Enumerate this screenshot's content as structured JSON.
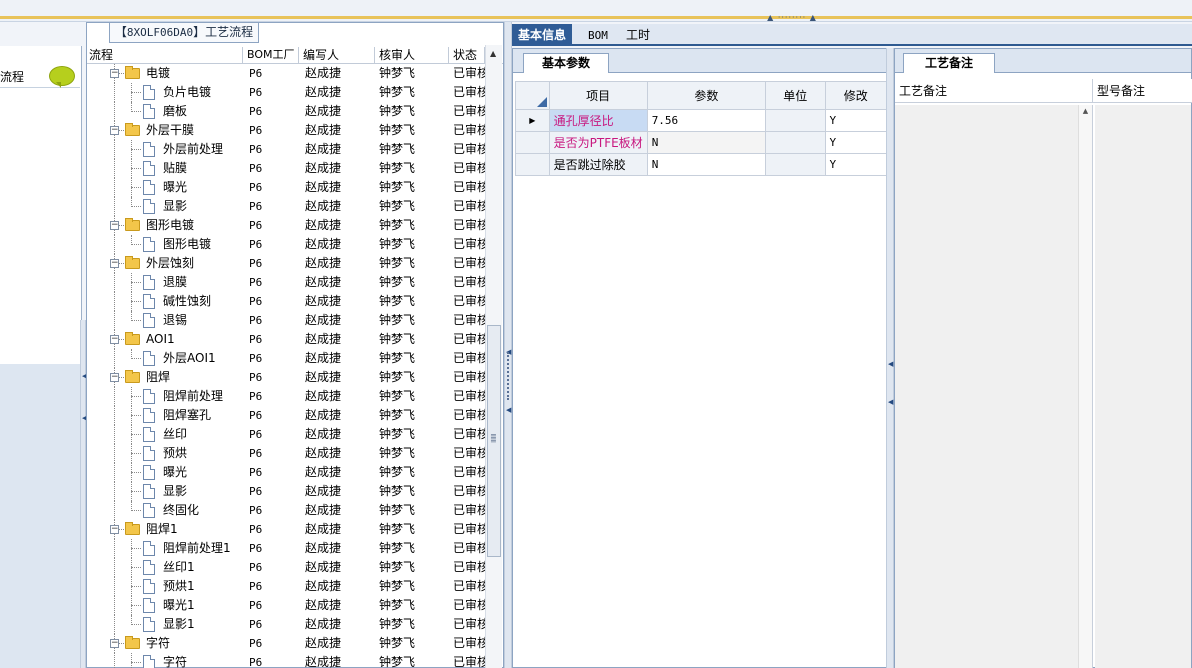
{
  "tree_panel": {
    "title_bracket_open": "【",
    "title_code": "8XOLF06DA0",
    "title_bracket_close": "】",
    "title_text": "工艺流程",
    "columns": [
      "流程",
      "BOM工厂",
      "编写人",
      "核审人",
      "状态"
    ],
    "rows": [
      {
        "name": "电镀",
        "type": "folder",
        "bom": "P6",
        "author": "赵成捷",
        "reviewer": "钟梦飞",
        "status": "已审核"
      },
      {
        "name": "负片电镀",
        "type": "doc",
        "bom": "P6",
        "author": "赵成捷",
        "reviewer": "钟梦飞",
        "status": "已审核"
      },
      {
        "name": "磨板",
        "type": "doc",
        "bom": "P6",
        "author": "赵成捷",
        "reviewer": "钟梦飞",
        "status": "已审核",
        "last": true
      },
      {
        "name": "外层干膜",
        "type": "folder",
        "bom": "P6",
        "author": "赵成捷",
        "reviewer": "钟梦飞",
        "status": "已审核"
      },
      {
        "name": "外层前处理",
        "type": "doc",
        "bom": "P6",
        "author": "赵成捷",
        "reviewer": "钟梦飞",
        "status": "已审核"
      },
      {
        "name": "贴膜",
        "type": "doc",
        "bom": "P6",
        "author": "赵成捷",
        "reviewer": "钟梦飞",
        "status": "已审核"
      },
      {
        "name": "曝光",
        "type": "doc",
        "bom": "P6",
        "author": "赵成捷",
        "reviewer": "钟梦飞",
        "status": "已审核"
      },
      {
        "name": "显影",
        "type": "doc",
        "bom": "P6",
        "author": "赵成捷",
        "reviewer": "钟梦飞",
        "status": "已审核",
        "last": true
      },
      {
        "name": "图形电镀",
        "type": "folder",
        "bom": "P6",
        "author": "赵成捷",
        "reviewer": "钟梦飞",
        "status": "已审核"
      },
      {
        "name": "图形电镀",
        "type": "doc",
        "bom": "P6",
        "author": "赵成捷",
        "reviewer": "钟梦飞",
        "status": "已审核",
        "last": true
      },
      {
        "name": "外层蚀刻",
        "type": "folder",
        "bom": "P6",
        "author": "赵成捷",
        "reviewer": "钟梦飞",
        "status": "已审核"
      },
      {
        "name": "退膜",
        "type": "doc",
        "bom": "P6",
        "author": "赵成捷",
        "reviewer": "钟梦飞",
        "status": "已审核"
      },
      {
        "name": "碱性蚀刻",
        "type": "doc",
        "bom": "P6",
        "author": "赵成捷",
        "reviewer": "钟梦飞",
        "status": "已审核"
      },
      {
        "name": "退锡",
        "type": "doc",
        "bom": "P6",
        "author": "赵成捷",
        "reviewer": "钟梦飞",
        "status": "已审核",
        "last": true
      },
      {
        "name": "AOI1",
        "type": "folder",
        "bom": "P6",
        "author": "赵成捷",
        "reviewer": "钟梦飞",
        "status": "已审核"
      },
      {
        "name": "外层AOI1",
        "type": "doc",
        "bom": "P6",
        "author": "赵成捷",
        "reviewer": "钟梦飞",
        "status": "已审核",
        "last": true
      },
      {
        "name": "阻焊",
        "type": "folder",
        "bom": "P6",
        "author": "赵成捷",
        "reviewer": "钟梦飞",
        "status": "已审核"
      },
      {
        "name": "阻焊前处理",
        "type": "doc",
        "bom": "P6",
        "author": "赵成捷",
        "reviewer": "钟梦飞",
        "status": "已审核"
      },
      {
        "name": "阻焊塞孔",
        "type": "doc",
        "bom": "P6",
        "author": "赵成捷",
        "reviewer": "钟梦飞",
        "status": "已审核"
      },
      {
        "name": "丝印",
        "type": "doc",
        "bom": "P6",
        "author": "赵成捷",
        "reviewer": "钟梦飞",
        "status": "已审核"
      },
      {
        "name": "预烘",
        "type": "doc",
        "bom": "P6",
        "author": "赵成捷",
        "reviewer": "钟梦飞",
        "status": "已审核"
      },
      {
        "name": "曝光",
        "type": "doc",
        "bom": "P6",
        "author": "赵成捷",
        "reviewer": "钟梦飞",
        "status": "已审核"
      },
      {
        "name": "显影",
        "type": "doc",
        "bom": "P6",
        "author": "赵成捷",
        "reviewer": "钟梦飞",
        "status": "已审核"
      },
      {
        "name": "终固化",
        "type": "doc",
        "bom": "P6",
        "author": "赵成捷",
        "reviewer": "钟梦飞",
        "status": "已审核",
        "last": true
      },
      {
        "name": "阻焊1",
        "type": "folder",
        "bom": "P6",
        "author": "赵成捷",
        "reviewer": "钟梦飞",
        "status": "已审核"
      },
      {
        "name": "阻焊前处理1",
        "type": "doc",
        "bom": "P6",
        "author": "赵成捷",
        "reviewer": "钟梦飞",
        "status": "已审核"
      },
      {
        "name": "丝印1",
        "type": "doc",
        "bom": "P6",
        "author": "赵成捷",
        "reviewer": "钟梦飞",
        "status": "已审核"
      },
      {
        "name": "预烘1",
        "type": "doc",
        "bom": "P6",
        "author": "赵成捷",
        "reviewer": "钟梦飞",
        "status": "已审核"
      },
      {
        "name": "曝光1",
        "type": "doc",
        "bom": "P6",
        "author": "赵成捷",
        "reviewer": "钟梦飞",
        "status": "已审核"
      },
      {
        "name": "显影1",
        "type": "doc",
        "bom": "P6",
        "author": "赵成捷",
        "reviewer": "钟梦飞",
        "status": "已审核",
        "last": true
      },
      {
        "name": "字符",
        "type": "folder",
        "bom": "P6",
        "author": "赵成捷",
        "reviewer": "钟梦飞",
        "status": "已审核"
      },
      {
        "name": "字符",
        "type": "doc",
        "bom": "P6",
        "author": "赵成捷",
        "reviewer": "钟梦飞",
        "status": "已审核"
      }
    ]
  },
  "left_pane": {
    "label": "流程"
  },
  "main_tabs": [
    {
      "label": "基本信息",
      "active": true
    },
    {
      "label": "BOM",
      "active": false
    },
    {
      "label": "工时",
      "active": false
    }
  ],
  "params_panel": {
    "tab": "基本参数",
    "columns": [
      "项目",
      "参数",
      "单位",
      "修改"
    ],
    "rows": [
      {
        "item": "通孔厚径比",
        "value": "7.56",
        "unit": "",
        "modify": "Y",
        "selected": true
      },
      {
        "item": "是否为PTFE板材",
        "value": "N",
        "unit": "",
        "modify": "Y"
      },
      {
        "item": "是否跳过除胶",
        "value": "N",
        "unit": "",
        "modify": "Y"
      }
    ]
  },
  "remarks_panel": {
    "tab": "工艺备注",
    "columns": [
      "工艺备注",
      "型号备注"
    ]
  },
  "colors": {
    "accent": "#2f5c96",
    "highlight_text": "#c8177f",
    "folder": "#f3c64a"
  }
}
